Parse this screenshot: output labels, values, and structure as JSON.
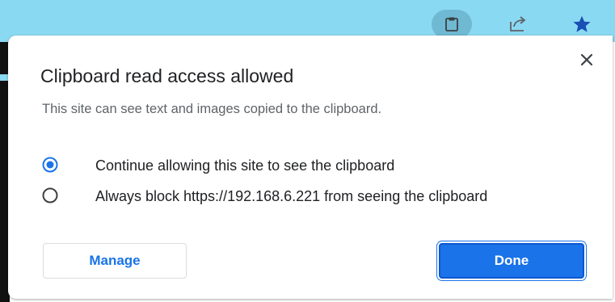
{
  "colors": {
    "toolbar_bg": "#8ad9f2",
    "accent": "#1a73e8",
    "secondary_text": "#5f6368"
  },
  "toolbar": {
    "icons": [
      "clipboard-icon",
      "share-icon",
      "bookmark-star-icon"
    ]
  },
  "dialog": {
    "title": "Clipboard read access allowed",
    "description": "This site can see text and images copied to the clipboard.",
    "close_icon": "close-icon",
    "options": [
      {
        "label": "Continue allowing this site to see the clipboard",
        "selected": true
      },
      {
        "label": "Always block https://192.168.6.221 from seeing the clipboard",
        "selected": false
      }
    ],
    "manage_label": "Manage",
    "done_label": "Done"
  }
}
